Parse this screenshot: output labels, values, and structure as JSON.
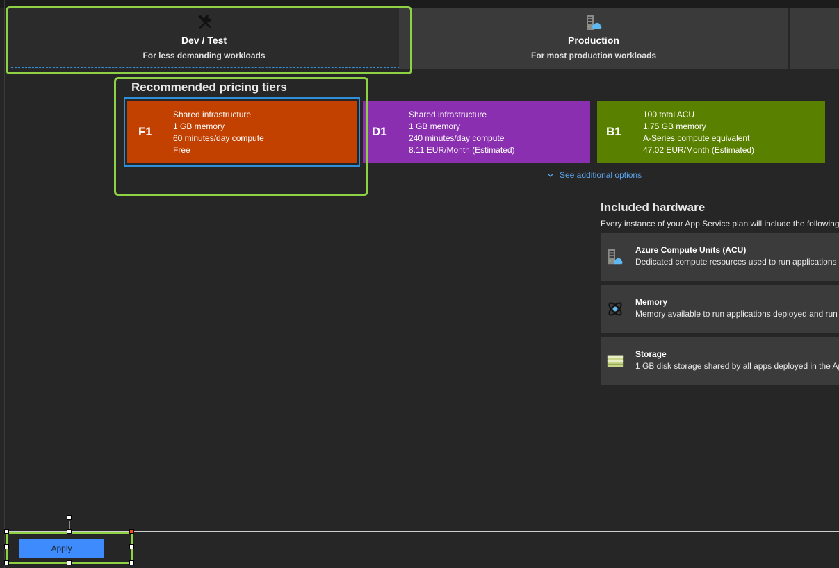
{
  "tabs": [
    {
      "title": "Dev / Test",
      "subtitle": "For less demanding workloads",
      "icon": "tools-icon",
      "selected": true
    },
    {
      "title": "Production",
      "subtitle": "For most production workloads",
      "icon": "server-cloud-icon",
      "selected": false
    }
  ],
  "recommended": {
    "title": "Recommended pricing tiers",
    "tiers": [
      {
        "code": "F1",
        "color": "#c24000",
        "selected": true,
        "lines": [
          "Shared infrastructure",
          "1 GB memory",
          "60 minutes/day compute",
          "Free"
        ]
      },
      {
        "code": "D1",
        "color": "#8a2fb0",
        "selected": false,
        "lines": [
          "Shared infrastructure",
          "1 GB memory",
          "240 minutes/day compute",
          "8.11 EUR/Month (Estimated)"
        ]
      },
      {
        "code": "B1",
        "color": "#5a8000",
        "selected": false,
        "lines": [
          "100 total ACU",
          "1.75 GB memory",
          "A-Series compute equivalent",
          "47.02 EUR/Month (Estimated)"
        ]
      }
    ],
    "more_label": "See additional options"
  },
  "hardware": {
    "title": "Included hardware",
    "subtitle": "Every instance of your App Service plan will include the following",
    "items": [
      {
        "name": "Azure Compute Units (ACU)",
        "desc": "Dedicated compute resources used to run applications d",
        "icon": "server-cloud-icon"
      },
      {
        "name": "Memory",
        "desc": "Memory available to run applications deployed and run",
        "icon": "memory-icon"
      },
      {
        "name": "Storage",
        "desc": "1 GB disk storage shared by all apps deployed in the Ap",
        "icon": "storage-icon"
      }
    ]
  },
  "footer": {
    "apply_label": "Apply"
  },
  "colors": {
    "accent": "#3d8bfd",
    "highlight": "#8ed145",
    "selection": "#2f8fd8"
  }
}
